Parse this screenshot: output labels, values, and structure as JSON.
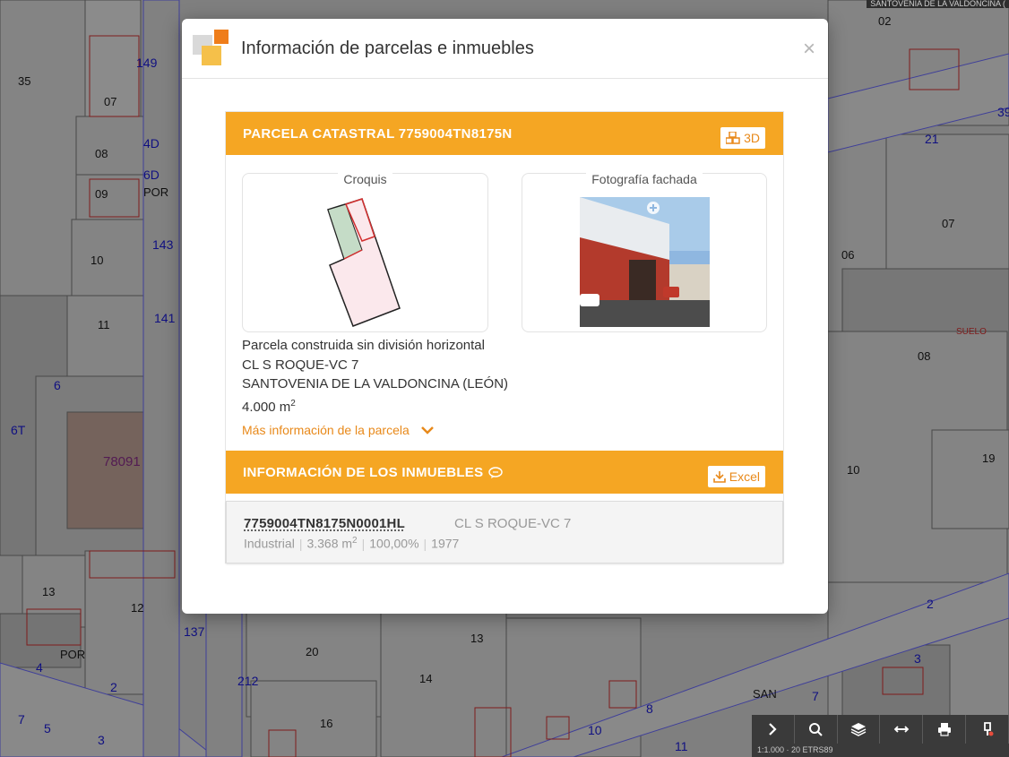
{
  "map": {
    "parcel_numbers": [
      "35",
      "07",
      "08",
      "09",
      "POR",
      "10",
      "11",
      "13",
      "12",
      "POR",
      "20",
      "14",
      "16",
      "13",
      "02",
      "07",
      "06",
      "08",
      "10",
      "19",
      "78091",
      "SAN"
    ],
    "street_numbers": [
      "149",
      "4D",
      "6D",
      "143",
      "141",
      "6",
      "137",
      "212",
      "4",
      "2",
      "7",
      "5",
      "3",
      "10",
      "8",
      "11",
      "21",
      "2",
      "3",
      "7",
      "1",
      "6T",
      "39"
    ],
    "overlay_label": "SANTOVENIA DE LA VALDONCINA (",
    "suelo_label": "SUELO",
    "scale_text": "1:1.000 · 20 ETRS89"
  },
  "toolbar": {
    "buttons": [
      "chevron-right-icon",
      "search-icon",
      "layers-icon",
      "measure-icon",
      "print-icon",
      "pin-icon"
    ]
  },
  "modal": {
    "title": "Información de parcelas e inmuebles",
    "close_label": "×",
    "parcel": {
      "header": "PARCELA CATASTRAL 7759004TN8175N",
      "btn_3d_label": "3D",
      "croquis_title": "Croquis",
      "photo_title": "Fotografía fachada",
      "description": "Parcela construida sin división horizontal",
      "address": "CL S ROQUE-VC 7",
      "municipality": "SANTOVENIA DE LA VALDONCINA (LEÓN)",
      "surface": "4.000 m",
      "surface_sup": "2",
      "more_info": "Más información de la parcela"
    },
    "inmuebles": {
      "header": "INFORMACIÓN DE LOS INMUEBLES",
      "excel_label": "Excel",
      "items": [
        {
          "ref": "7759004TN8175N0001HL",
          "address": "CL S ROQUE-VC 7",
          "use": "Industrial",
          "surface": "3.368 m",
          "surface_sup": "2",
          "share": "100,00%",
          "year": "1977"
        }
      ]
    }
  },
  "colors": {
    "accent": "#f5a623",
    "accent_text": "#e8891a",
    "map_base": "#b9b9b9",
    "map_lines_blue": "#1b1bd8",
    "map_lines_red": "#d23030"
  }
}
